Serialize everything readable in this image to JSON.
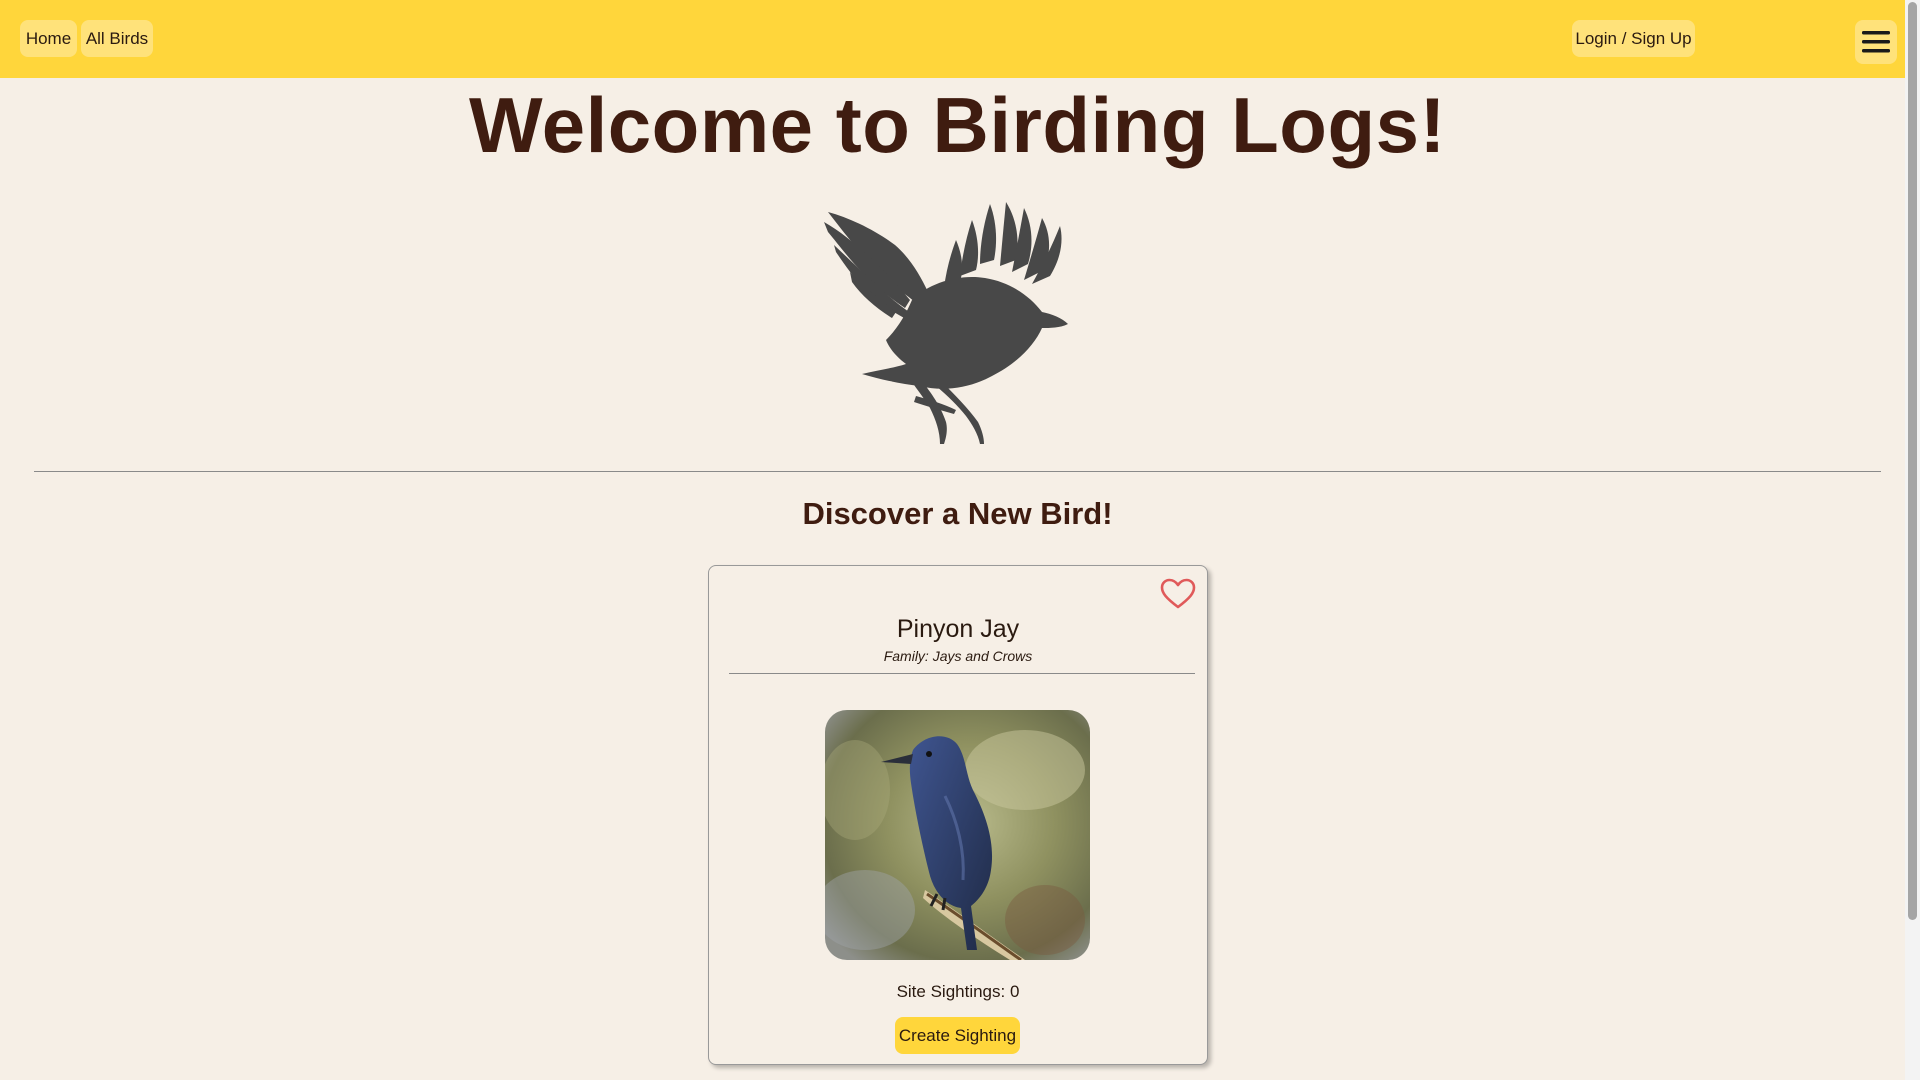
{
  "nav": {
    "home_label": "Home",
    "all_birds_label": "All Birds",
    "login_label": "Login / Sign Up",
    "menu_icon": "hamburger-menu-icon"
  },
  "main": {
    "title": "Welcome to Birding Logs!",
    "hero_icon": "bird-silhouette-icon",
    "section_title": "Discover a New Bird!"
  },
  "bird_card": {
    "name": "Pinyon Jay",
    "family": "Family: Jays and Crows",
    "favorite_icon": "heart-outline-icon",
    "sightings": "Site Sightings: 0",
    "create_label": "Create Sighting"
  },
  "colors": {
    "navbar": "#ffd63b",
    "nav_button": "#ffe27a",
    "background": "#f6efe6",
    "text": "#3f1c10",
    "heart": "#e05a5a",
    "silhouette": "#484848"
  }
}
